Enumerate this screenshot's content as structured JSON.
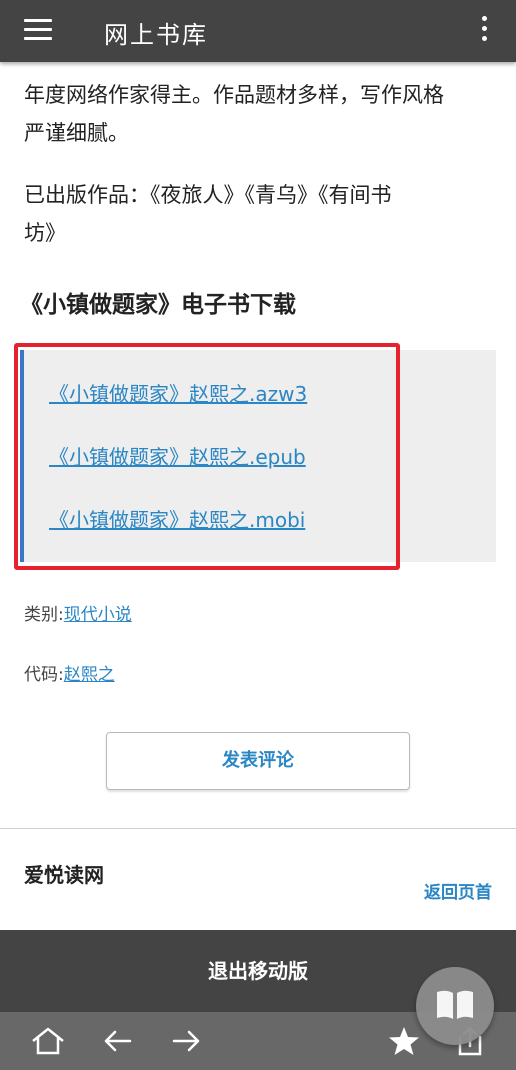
{
  "appbar": {
    "title": "网上书库"
  },
  "author_intro": {
    "line1": "年度网络作家得主。作品题材多样，写作风格",
    "line2": "严谨细腻。",
    "published_line1": "已出版作品：《夜旅人》《青乌》《有间书",
    "published_line2": "坊》"
  },
  "downloads": {
    "title": "《小镇做题家》电子书下载",
    "links": [
      "《小镇做题家》赵熙之.azw3",
      "《小镇做题家》赵熙之.epub",
      "《小镇做题家》赵熙之.mobi"
    ]
  },
  "meta": {
    "category_label": "类别:",
    "category_value": "现代小说",
    "code_label": "代码:",
    "code_value": "赵熙之"
  },
  "comment_button": "发表评论",
  "footer": {
    "brand": "爱悦读网",
    "back_to_top": "返回页首"
  },
  "exit_bar": "退出移动版",
  "icons": {
    "menu": "menu-icon",
    "more": "more-vertical-icon",
    "home": "home-icon",
    "back": "arrow-left-icon",
    "forward": "arrow-right-icon",
    "bookmark": "star-icon",
    "share": "share-icon",
    "reader": "book-icon"
  },
  "colors": {
    "appbar": "#444444",
    "link": "#2a86c4",
    "highlight": "#e5222e",
    "box_bg": "#eeeeee",
    "toolbar": "#686868"
  }
}
